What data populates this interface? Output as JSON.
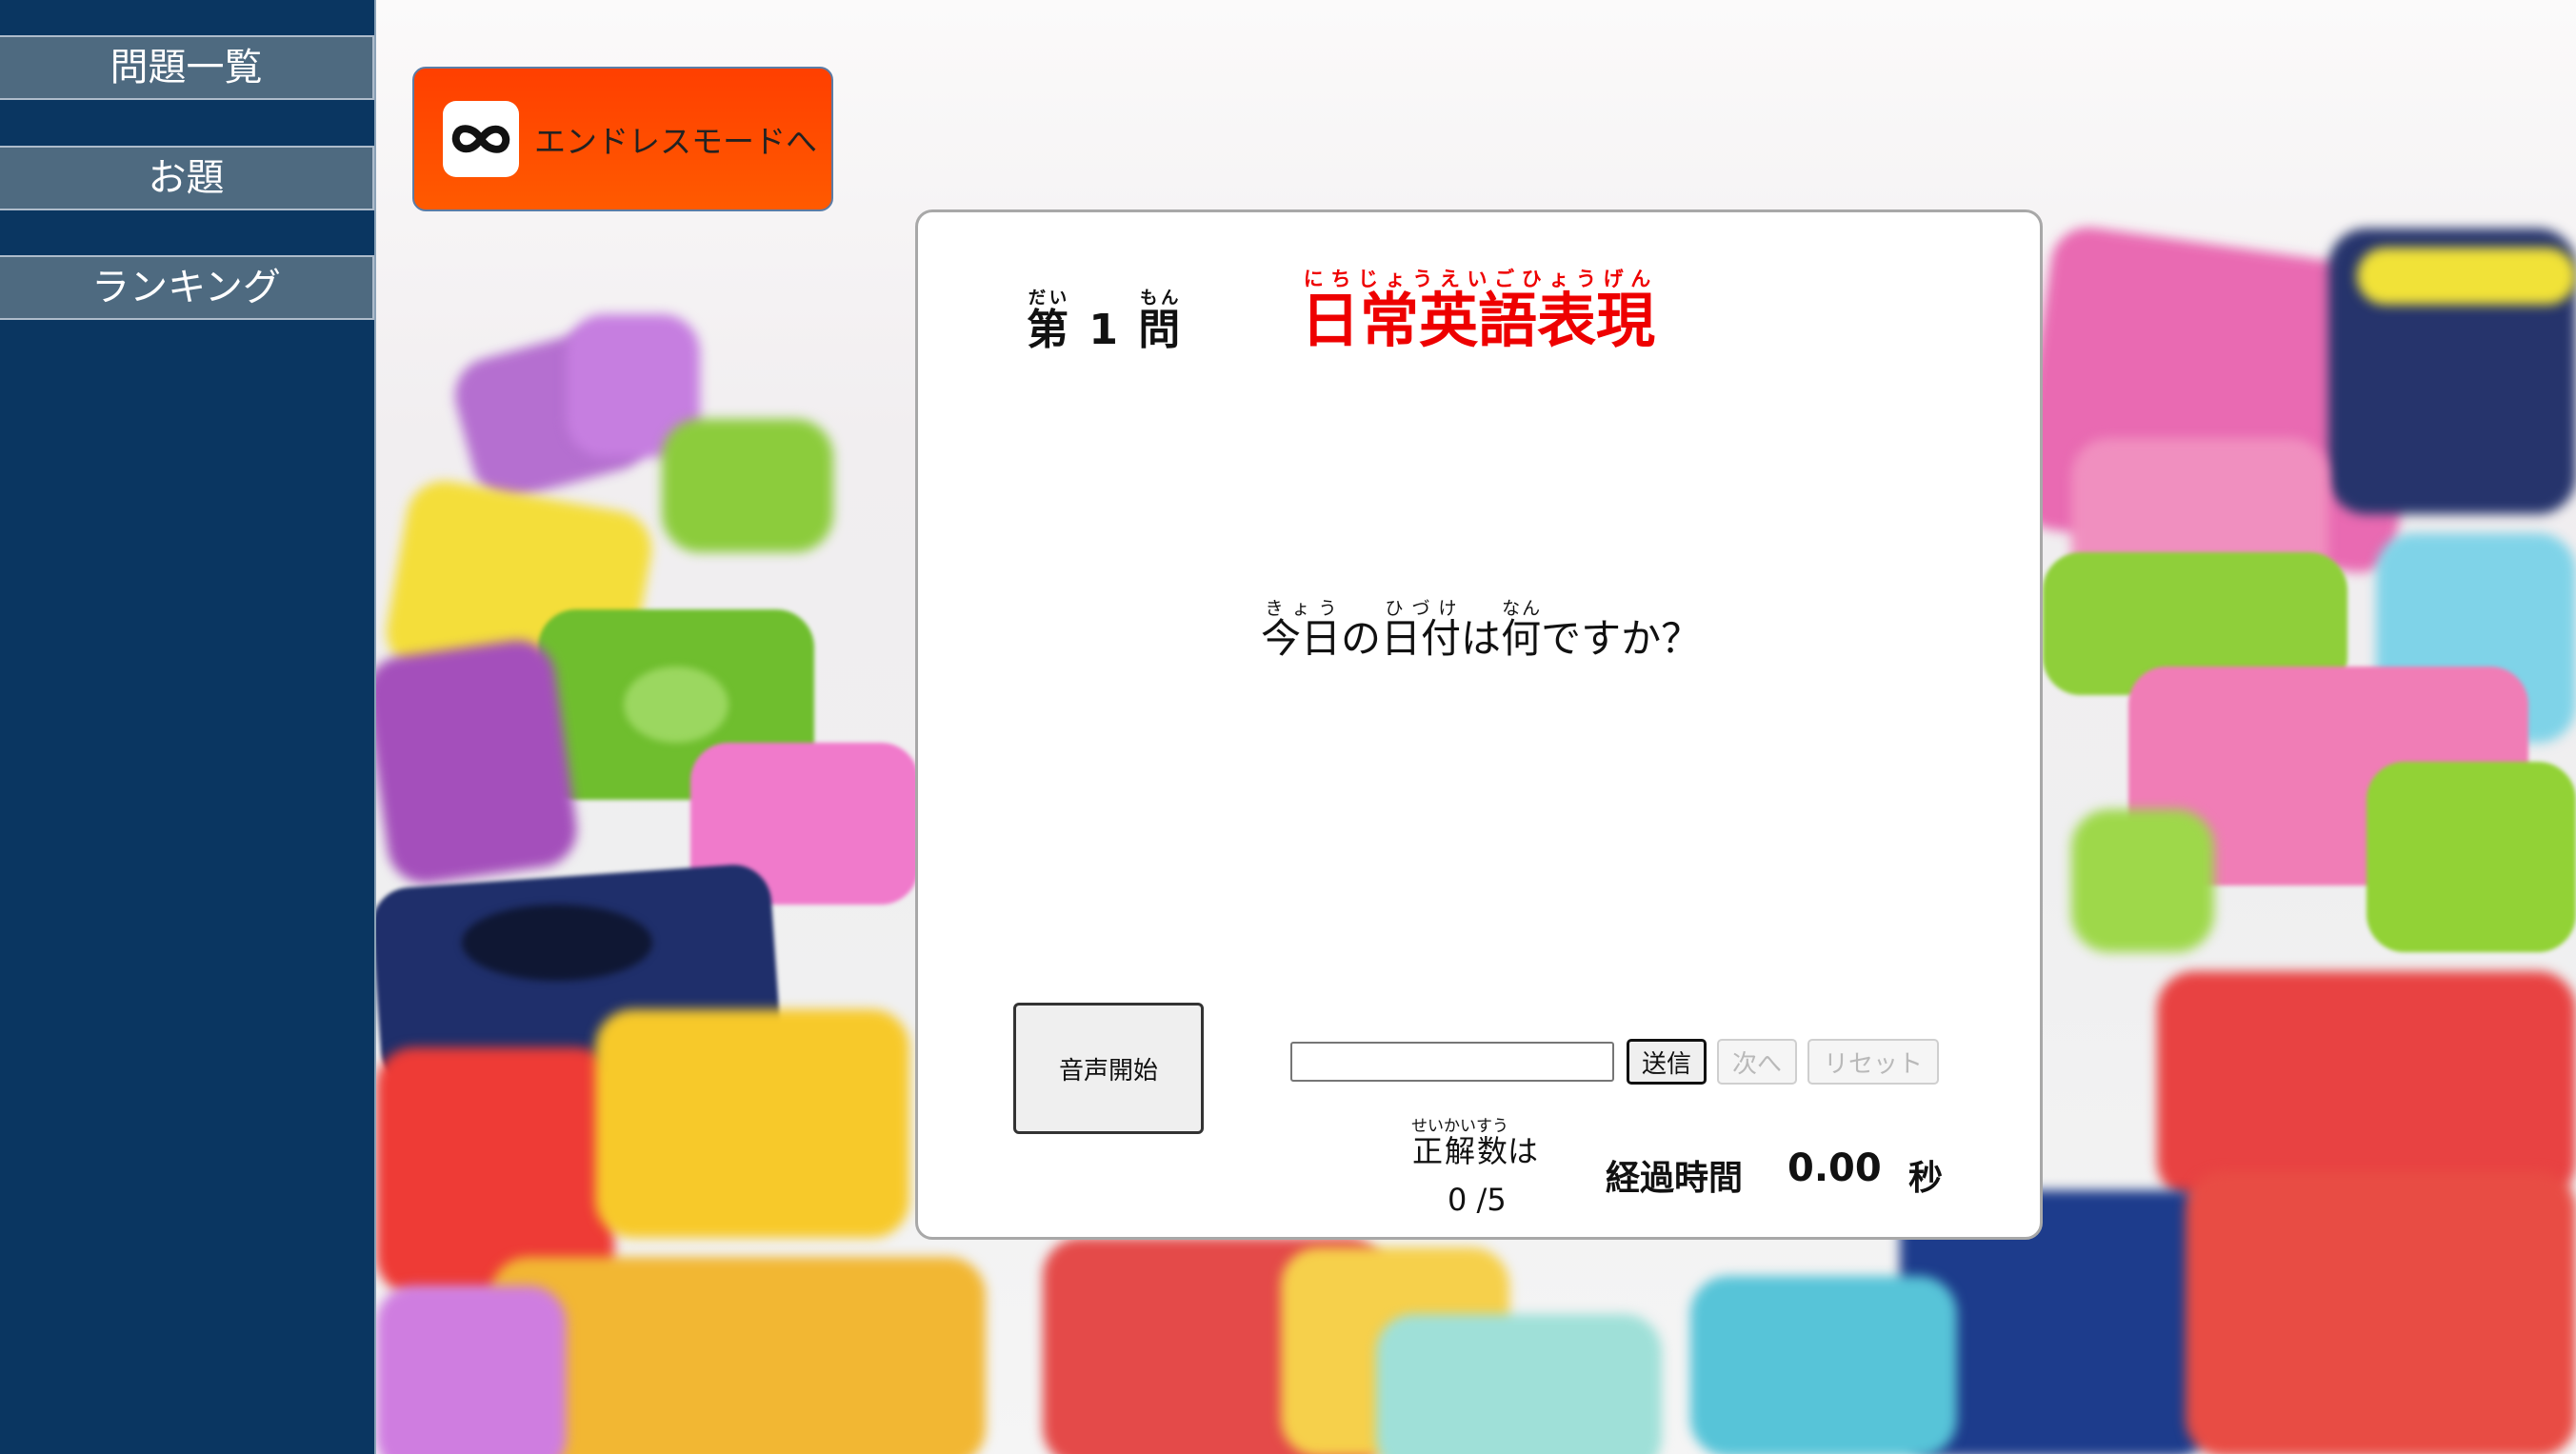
{
  "sidebar": {
    "items": [
      {
        "label": "問題一覧"
      },
      {
        "label": "お題"
      },
      {
        "label": "ランキング"
      }
    ]
  },
  "endless_button": {
    "label": "エンドレスモードへ",
    "icon": "infinity-icon"
  },
  "quiz": {
    "number_prefix": "第",
    "number_prefix_ruby": "だい",
    "number": "1",
    "number_suffix": "問",
    "number_suffix_ruby": "もん",
    "title": "日常英語表現",
    "title_ruby": "にちじょうえいごひょうげん",
    "question": {
      "kyou": "今日",
      "kyou_ruby": "きょう",
      "no": "の",
      "hizuke": "日付",
      "hizuke_ruby": "ひづけ",
      "wa": "は",
      "nani": "何",
      "nani_ruby": "なん",
      "tail": "ですか？"
    },
    "voice_button": "音声開始",
    "answer_value": "",
    "send_button": "送信",
    "next_button": "次へ",
    "reset_button": "リセット",
    "score_label": "正解数",
    "score_label_ruby": "せいかいすう",
    "score_label_tail": "は",
    "score_value": "0 /5",
    "time_label": "経過時間",
    "time_value": "0.00",
    "time_unit": "秒"
  },
  "colors": {
    "sidebar_bg": "#0a3661",
    "nav_item_bg": "#4e6a80",
    "endless_bg": "#ff4a00",
    "title_red": "#ee0000"
  }
}
